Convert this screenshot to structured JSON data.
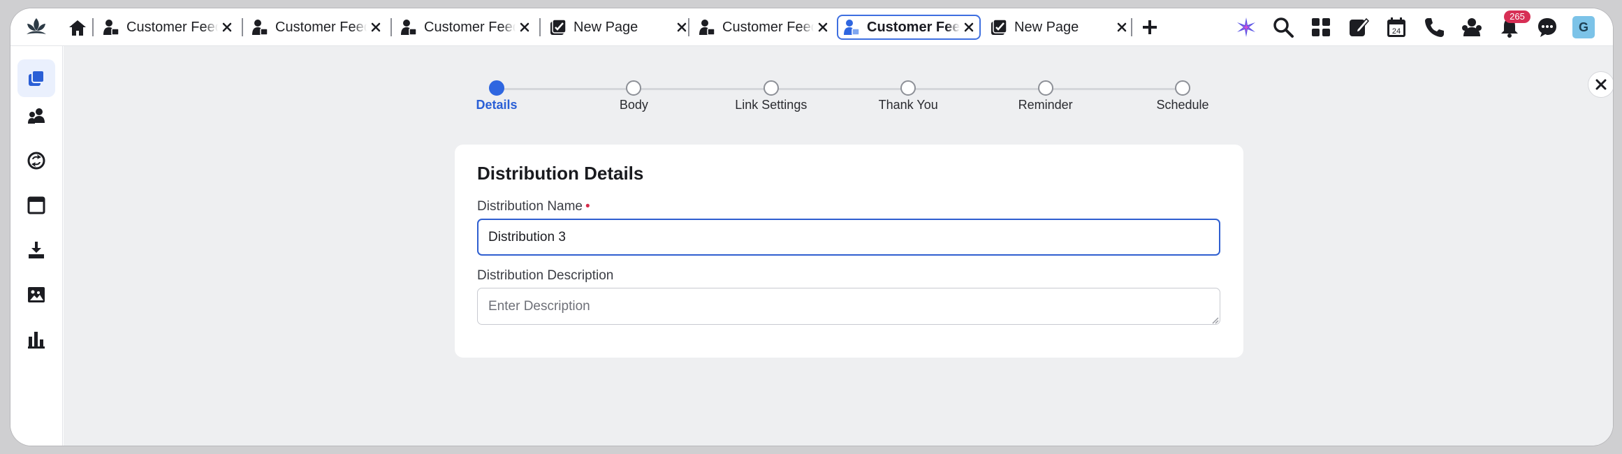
{
  "tabs": [
    {
      "label": "Customer Feedback",
      "icon": "customer-feedback-icon",
      "active": false
    },
    {
      "label": "Customer Feedback",
      "icon": "customer-feedback-icon",
      "active": false
    },
    {
      "label": "Customer Feedback",
      "icon": "customer-feedback-icon",
      "active": false
    },
    {
      "label": "New Page",
      "icon": "new-page-icon",
      "active": false
    },
    {
      "label": "Customer Feedback",
      "icon": "customer-feedback-icon",
      "active": false
    },
    {
      "label": "Customer Feedback",
      "icon": "customer-feedback-icon",
      "active": true
    },
    {
      "label": "New Page",
      "icon": "new-page-icon",
      "active": false
    }
  ],
  "toolbar_icons": [
    "sparkle-icon",
    "search-icon",
    "apps-grid-icon",
    "compose-icon",
    "calendar-icon",
    "phone-icon",
    "agent-icon",
    "notification-bell-icon",
    "chat-icon"
  ],
  "calendar_day": "24",
  "notifications": {
    "count": "265"
  },
  "user": {
    "avatar_initial": "G"
  },
  "sidebar": {
    "items": [
      {
        "name": "copy-pages-icon",
        "active": true
      },
      {
        "name": "people-icon",
        "active": false
      },
      {
        "name": "refresh-cycle-icon",
        "active": false
      },
      {
        "name": "window-icon",
        "active": false
      },
      {
        "name": "download-icon",
        "active": false
      },
      {
        "name": "media-gallery-icon",
        "active": false
      },
      {
        "name": "bar-chart-icon",
        "active": false
      }
    ]
  },
  "stepper": {
    "current": 0,
    "steps": [
      "Details",
      "Body",
      "Link Settings",
      "Thank You",
      "Reminder",
      "Schedule"
    ]
  },
  "form": {
    "title": "Distribution Details",
    "name_label": "Distribution Name",
    "required_mark": "•",
    "name_value": "Distribution 3",
    "description_label": "Distribution Description",
    "description_placeholder": "Enter Description",
    "description_value": ""
  },
  "colors": {
    "accent": "#2f66e0",
    "badge": "#d72f55",
    "main_bg": "#eeeff1"
  }
}
